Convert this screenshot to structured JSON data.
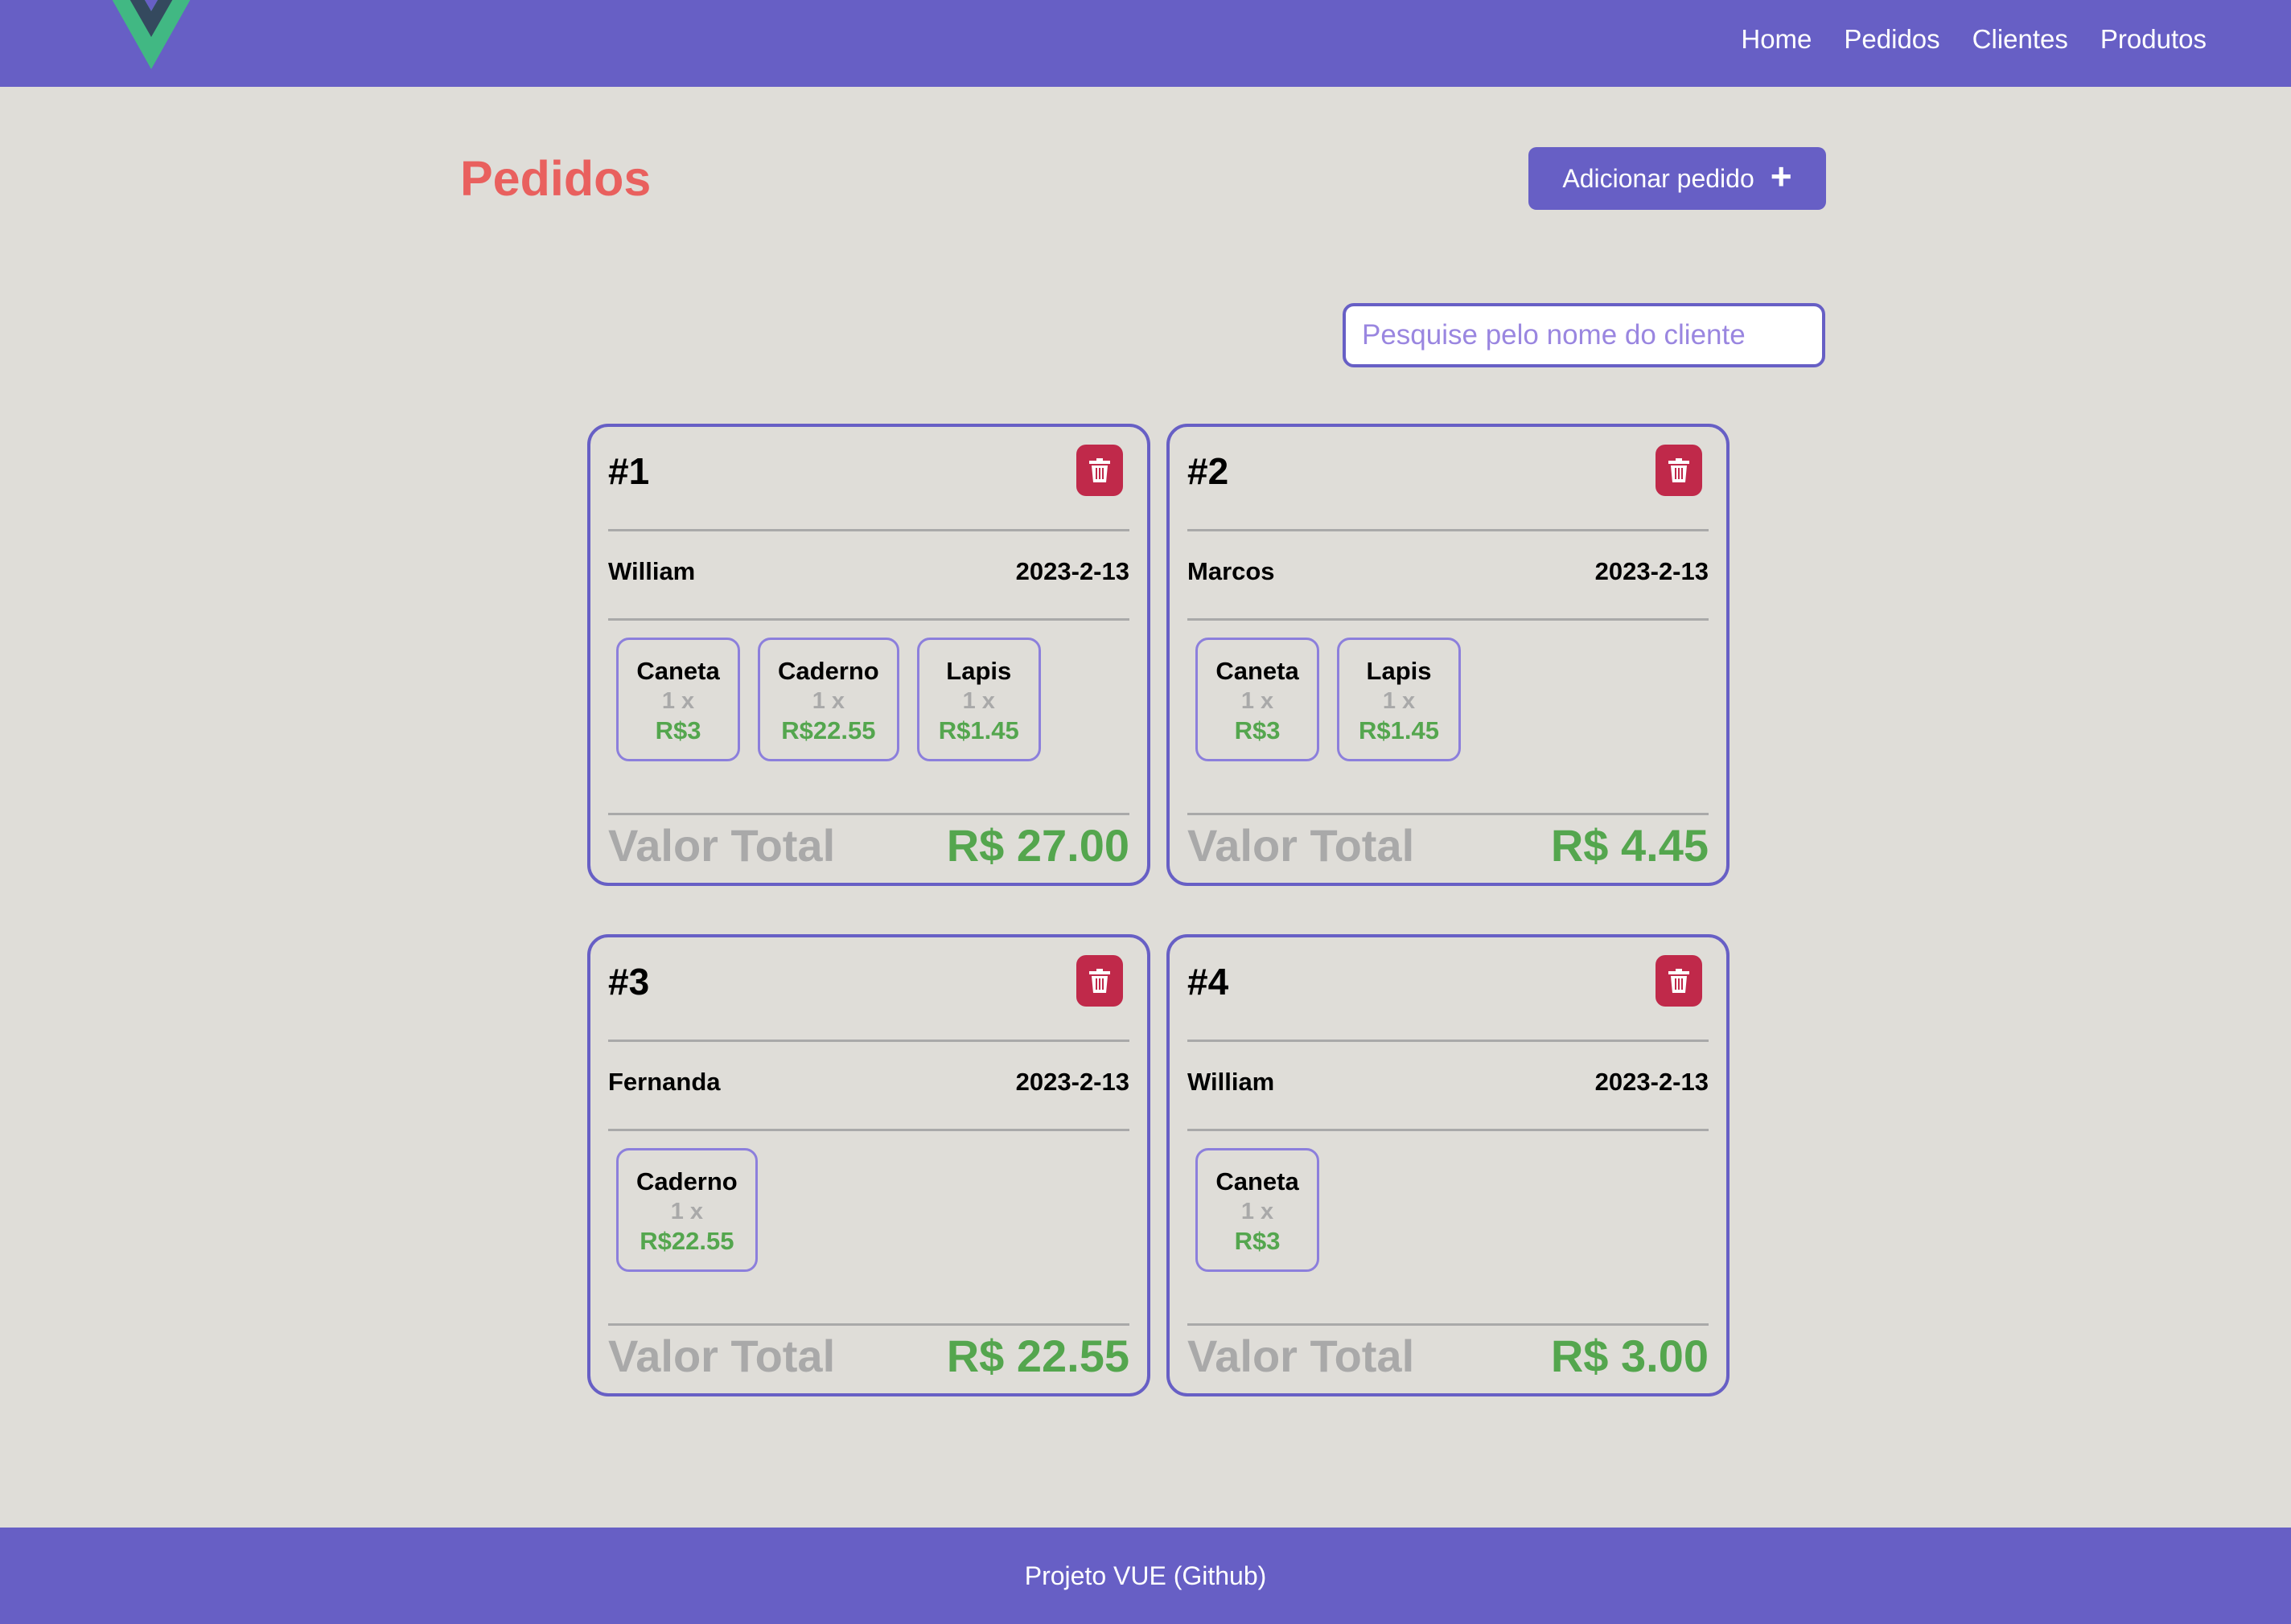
{
  "header": {
    "logo": "vue-logo",
    "nav": [
      "Home",
      "Pedidos",
      "Clientes",
      "Produtos"
    ]
  },
  "page": {
    "title": "Pedidos",
    "add_button": "Adicionar pedido",
    "add_icon": "+",
    "search_placeholder": "Pesquise pelo nome do cliente"
  },
  "orders": [
    {
      "number": "#1",
      "client": "William",
      "date": "2023-2-13",
      "products": [
        {
          "name": "Caneta",
          "qty": "1 x",
          "price": "R$3"
        },
        {
          "name": "Caderno",
          "qty": "1 x",
          "price": "R$22.55"
        },
        {
          "name": "Lapis",
          "qty": "1 x",
          "price": "R$1.45"
        }
      ],
      "total_label": "Valor Total",
      "total": "R$ 27.00"
    },
    {
      "number": "#2",
      "client": "Marcos",
      "date": "2023-2-13",
      "products": [
        {
          "name": "Caneta",
          "qty": "1 x",
          "price": "R$3"
        },
        {
          "name": "Lapis",
          "qty": "1 x",
          "price": "R$1.45"
        }
      ],
      "total_label": "Valor Total",
      "total": "R$ 4.45"
    },
    {
      "number": "#3",
      "client": "Fernanda",
      "date": "2023-2-13",
      "products": [
        {
          "name": "Caderno",
          "qty": "1 x",
          "price": "R$22.55"
        }
      ],
      "total_label": "Valor Total",
      "total": "R$ 22.55"
    },
    {
      "number": "#4",
      "client": "William",
      "date": "2023-2-13",
      "products": [
        {
          "name": "Caneta",
          "qty": "1 x",
          "price": "R$3"
        }
      ],
      "total_label": "Valor Total",
      "total": "R$ 3.00"
    }
  ],
  "footer": {
    "link": "Projeto VUE (Github)"
  },
  "colors": {
    "primary": "#675fc5",
    "title": "#e9605e",
    "delete": "#c0294a",
    "price": "#54a64e",
    "muted": "#a9a9a9",
    "background": "#dfddd8"
  }
}
